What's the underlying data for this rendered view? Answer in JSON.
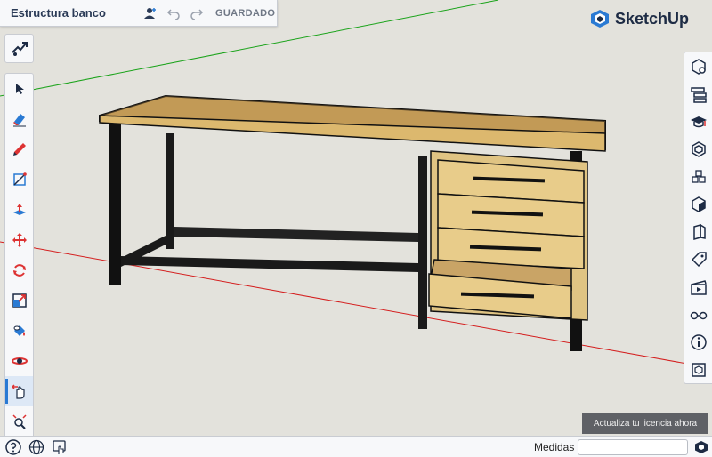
{
  "window": {
    "title": "Estructura banco",
    "saved_status": "GUARDADO"
  },
  "brand": {
    "name": "SketchUp",
    "color": "#1d2b44",
    "accent": "#2a7ad3"
  },
  "left_toolbar": {
    "top_tool": "scenes-icon",
    "tools": [
      "select-icon",
      "eraser-icon",
      "pencil-icon",
      "rectangle-icon",
      "push-pull-icon",
      "move-icon",
      "rotate-icon",
      "scale-icon",
      "paint-bucket-icon",
      "orbit-icon",
      "pan-icon",
      "zoom-extents-icon"
    ],
    "active_tool": "pan-icon"
  },
  "right_toolbar": {
    "tools": [
      "components-icon",
      "outliner-icon",
      "instructor-icon",
      "materials-icon",
      "entity-info-icon",
      "views-icon",
      "display-icon",
      "tags-icon",
      "scenes-panel-icon",
      "styles-icon",
      "info-icon",
      "3d-warehouse-icon"
    ]
  },
  "license_banner": {
    "label": "Actualiza tu licencia ahora"
  },
  "status_bar": {
    "measurements_label": "Medidas",
    "measurements_value": ""
  },
  "axes": {
    "green": "#1aa31a",
    "red": "#d41e1e"
  }
}
